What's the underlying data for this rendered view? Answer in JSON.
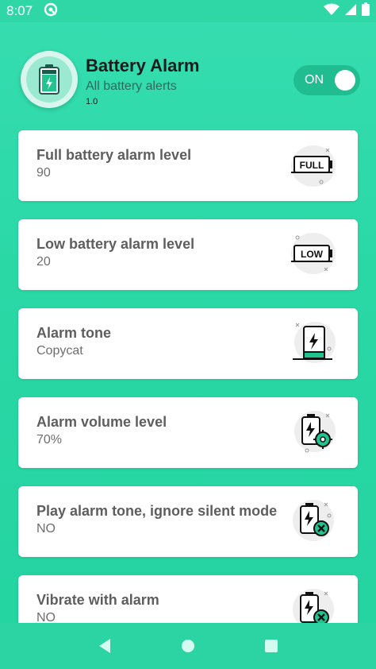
{
  "status": {
    "time": "8:07"
  },
  "header": {
    "title": "Battery Alarm",
    "subtitle": "All battery alerts",
    "version": "1.0",
    "toggle_label": "ON",
    "toggle_on": true
  },
  "settings": [
    {
      "title": "Full battery alarm level",
      "value": "90",
      "icon": "battery-full-icon",
      "icon_text": "FULL"
    },
    {
      "title": "Low battery alarm level",
      "value": "20",
      "icon": "battery-low-icon",
      "icon_text": "LOW"
    },
    {
      "title": "Alarm tone",
      "value": "Copycat",
      "icon": "phone-charging-icon"
    },
    {
      "title": "Alarm volume level",
      "value": "70%",
      "icon": "battery-settings-icon"
    },
    {
      "title": "Play alarm tone, ignore silent mode",
      "value": "NO",
      "icon": "battery-cancel-icon"
    },
    {
      "title": "Vibrate with alarm",
      "value": "NO",
      "icon": "battery-cancel-icon"
    }
  ],
  "colors": {
    "background": "#2ad8a6",
    "accent": "#1fbd8f",
    "icon_green": "#21c48f",
    "card": "#ffffff"
  },
  "nav": {
    "back": "back-icon",
    "home": "home-icon",
    "recents": "recents-icon"
  }
}
